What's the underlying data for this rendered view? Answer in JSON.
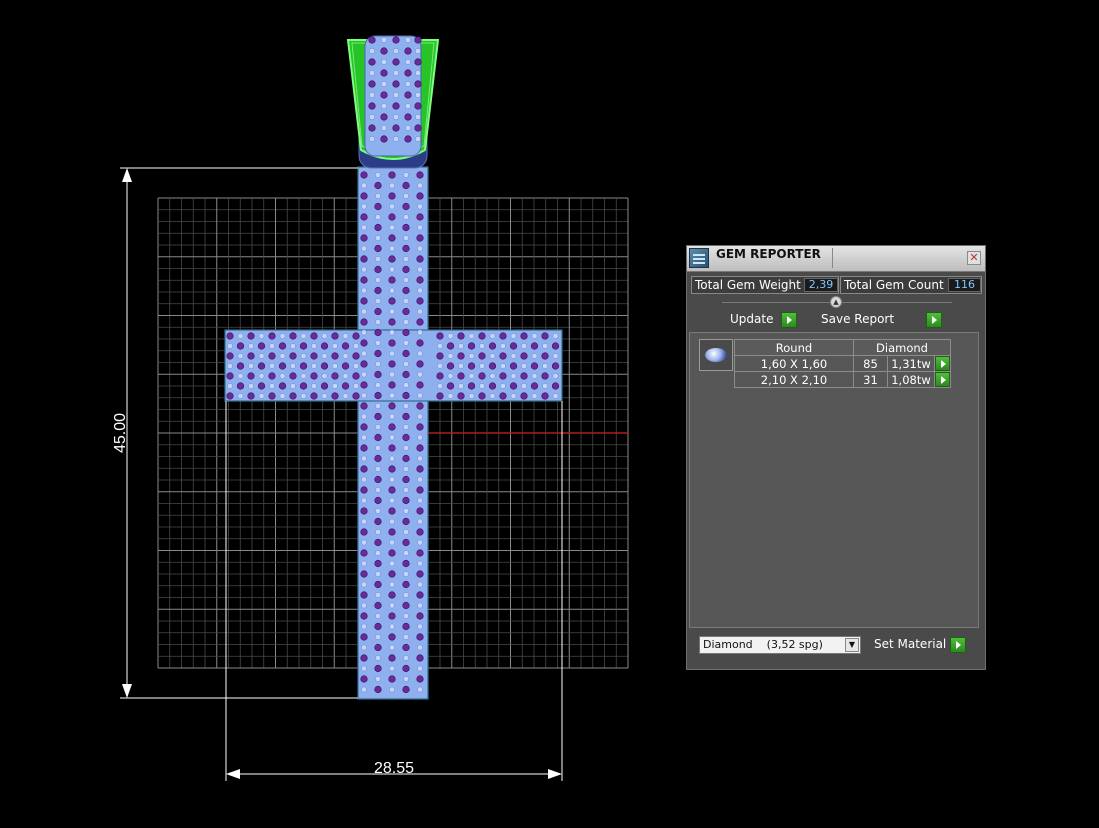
{
  "viewport": {
    "height_dimension": "45.00",
    "width_dimension": "28.55"
  },
  "gem_reporter": {
    "title": "GEM REPORTER",
    "close_glyph": "✕",
    "total_weight_label": "Total Gem Weight",
    "total_weight_value": "2,39",
    "total_count_label": "Total Gem Count",
    "total_count_value": "116",
    "update_label": "Update",
    "save_report_label": "Save Report",
    "table": {
      "headers": [
        "Round",
        "Diamond"
      ],
      "rows": [
        {
          "size": "1,60 X 1,60",
          "count": "85",
          "weight": "1,31tw"
        },
        {
          "size": "2,10 X 2,10",
          "count": "31",
          "weight": "1,08tw"
        }
      ]
    },
    "material_value": "Diamond    (3,52 spg)",
    "set_material_label": "Set Material"
  },
  "colors": {
    "background": "#000000",
    "grid": "#6a6a6a",
    "metal": "#8fb0f0",
    "gem": "#6a2a9a",
    "bail_highlight": "#38f038",
    "axis_red": "#c02020"
  }
}
